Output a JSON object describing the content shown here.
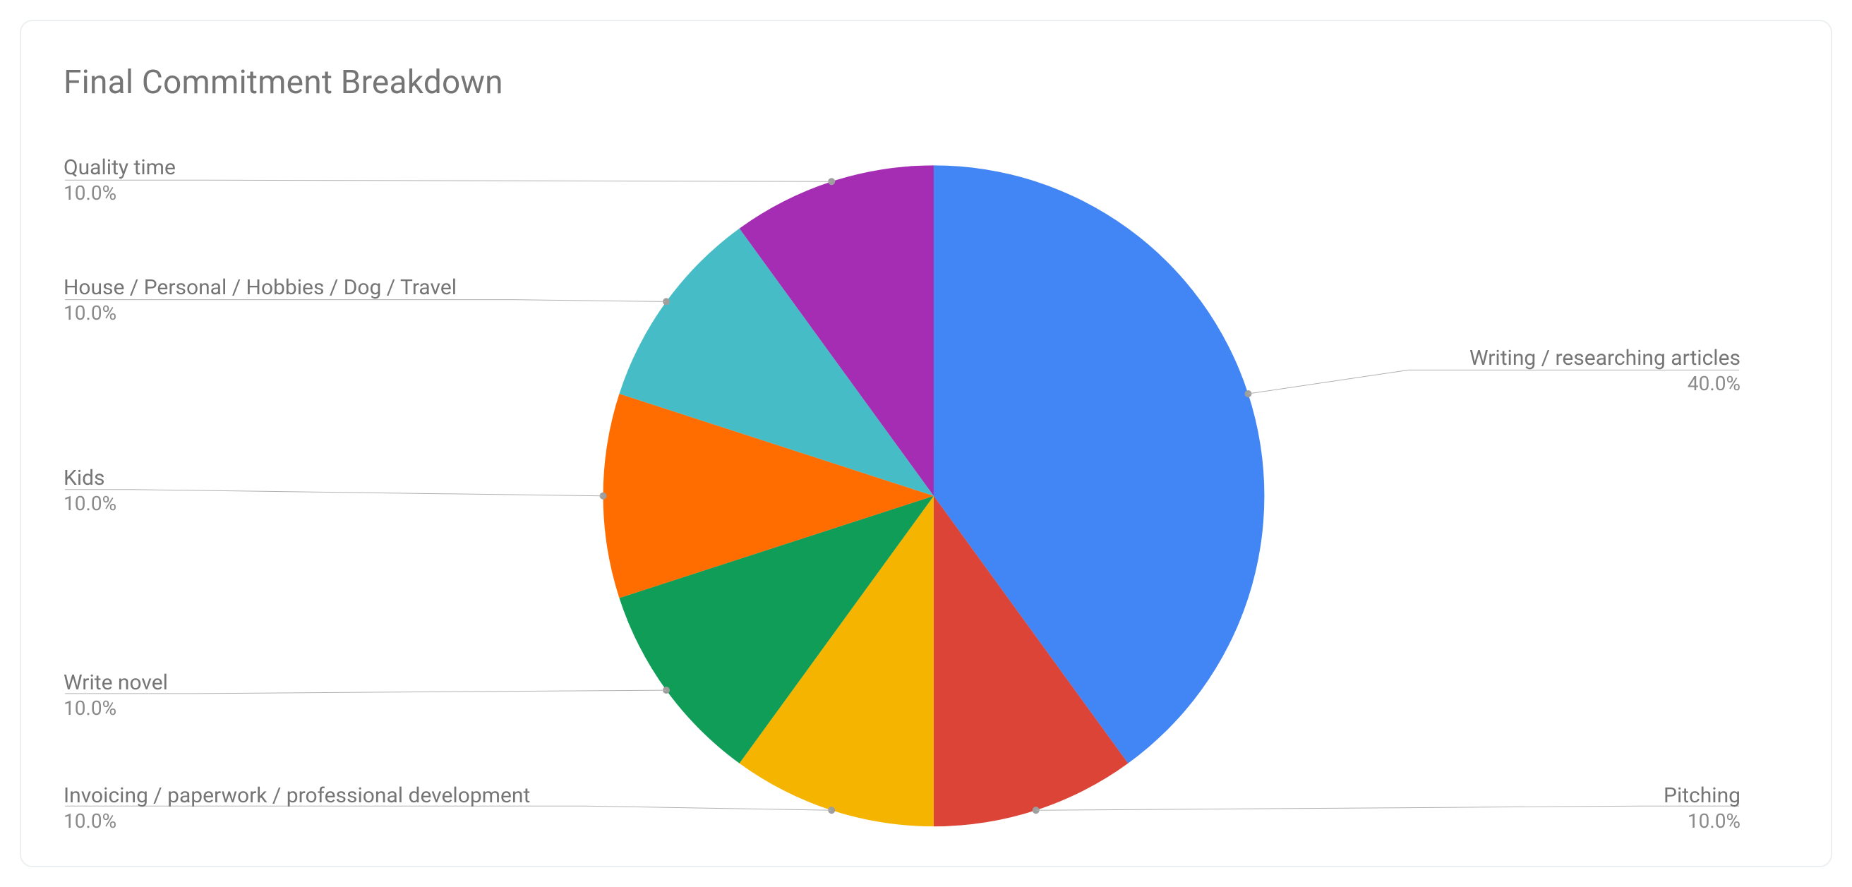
{
  "chart_data": {
    "type": "pie",
    "title": "Final Commitment Breakdown",
    "categories": [
      "Writing / researching articles",
      "Pitching",
      "Invoicing / paperwork / professional development",
      "Write novel",
      "Kids",
      "House / Personal / Hobbies / Dog / Travel",
      "Quality time"
    ],
    "values": [
      40,
      10,
      10,
      10,
      10,
      10,
      10
    ],
    "percent_labels": [
      "40.0%",
      "10.0%",
      "10.0%",
      "10.0%",
      "10.0%",
      "10.0%",
      "10.0%"
    ],
    "colors": [
      "#4285f4",
      "#db4437",
      "#f4b400",
      "#0f9d58",
      "#ff6d00",
      "#46bdc6",
      "#a52db3"
    ]
  }
}
